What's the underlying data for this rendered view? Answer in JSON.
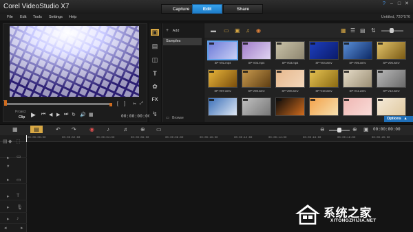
{
  "app": {
    "title": "Corel VideoStudio X7"
  },
  "tabs": [
    {
      "label": "Capture",
      "active": false
    },
    {
      "label": "Edit",
      "active": true
    },
    {
      "label": "Share",
      "active": false
    }
  ],
  "window_controls": [
    "help-icon",
    "minimize-icon",
    "maximize-icon",
    "close-icon"
  ],
  "menu": [
    {
      "label": "File"
    },
    {
      "label": "Edit"
    },
    {
      "label": "Tools"
    },
    {
      "label": "Settings"
    },
    {
      "label": "Help"
    }
  ],
  "project_info": "Untitled, 720*576",
  "preview": {
    "mode_project": "Project",
    "mode_clip": "Clip",
    "timecode": "00:00:00:00",
    "mark_in_icon": "[",
    "mark_out_icon": "]"
  },
  "library": {
    "add_label": "Add",
    "folders": [
      {
        "label": "Samples",
        "selected": true
      }
    ],
    "browse_label": "Browse",
    "options_label": "Options",
    "strip_icons": [
      "media-icon",
      "instant-project-icon",
      "transition-icon",
      "title-icon",
      "graphic-icon",
      "filter-icon",
      "path-icon"
    ],
    "thumbnails": [
      {
        "label": "SP-V01.mp4",
        "colors": [
          "#6c7ad8",
          "#c9cff5"
        ],
        "selected": true
      },
      {
        "label": "SP-V02.mp4",
        "colors": [
          "#a07cc8",
          "#e0d4f2"
        ],
        "selected": false
      },
      {
        "label": "SP-V03.mp4",
        "colors": [
          "#c9c2a8",
          "#8e8670"
        ],
        "selected": false
      },
      {
        "label": "SP-V04.wmv",
        "colors": [
          "#1d3fbf",
          "#0b1b6b"
        ],
        "selected": false
      },
      {
        "label": "SP-V05.wmv",
        "colors": [
          "#5a8fd8",
          "#0d2a66"
        ],
        "selected": false
      },
      {
        "label": "SP-V06.wmv",
        "colors": [
          "#e2c36a",
          "#7a5a14"
        ],
        "selected": false
      },
      {
        "label": "SP-V07.wmv",
        "colors": [
          "#e9b53a",
          "#7a4e0c"
        ],
        "selected": false
      },
      {
        "label": "SP-V08.wmv",
        "colors": [
          "#c89a4e",
          "#5e3d12"
        ],
        "selected": false
      },
      {
        "label": "SP-V09.wmv",
        "colors": [
          "#e7b98e",
          "#f3d7bb"
        ],
        "selected": false
      },
      {
        "label": "SP-V10.wmv",
        "colors": [
          "#e6c252",
          "#8a6a12"
        ],
        "selected": false
      },
      {
        "label": "SP-V11.wmv",
        "colors": [
          "#e6dcc8",
          "#9a8e74"
        ],
        "selected": false
      },
      {
        "label": "SP-V12.wmv",
        "colors": [
          "#b8b8b8",
          "#6a6a6a"
        ],
        "selected": false
      },
      {
        "label": "",
        "colors": [
          "#3a6fb8",
          "#dfe8f4"
        ],
        "selected": false
      },
      {
        "label": "",
        "colors": [
          "#c0c0c0",
          "#777777"
        ],
        "selected": false
      },
      {
        "label": "",
        "colors": [
          "#0a0a0a",
          "#d06c1e"
        ],
        "selected": false
      },
      {
        "label": "",
        "colors": [
          "#f3a24a",
          "#f6e0b0"
        ],
        "selected": false
      },
      {
        "label": "",
        "colors": [
          "#f0b7b3",
          "#f9dcd8"
        ],
        "selected": false
      },
      {
        "label": "",
        "colors": [
          "#f5ead8",
          "#e0c9a0"
        ],
        "selected": false
      }
    ]
  },
  "timeline": {
    "ruler_labels": [
      "00:00:00:00",
      "00:00:02:00",
      "00:00:04:00",
      "00:00:06:00",
      "00:00:08:00",
      "00:00:10:00",
      "00:00:12:00",
      "00:00:14:00",
      "00:00:16:00",
      "00:00:18:00",
      "00:00:20:00"
    ]
  },
  "watermark": {
    "text": "系统之家",
    "url": "XITONGZHIJIA.NET"
  },
  "colors": {
    "accent": "#2a8fe0",
    "trim": "#d06c1e"
  }
}
